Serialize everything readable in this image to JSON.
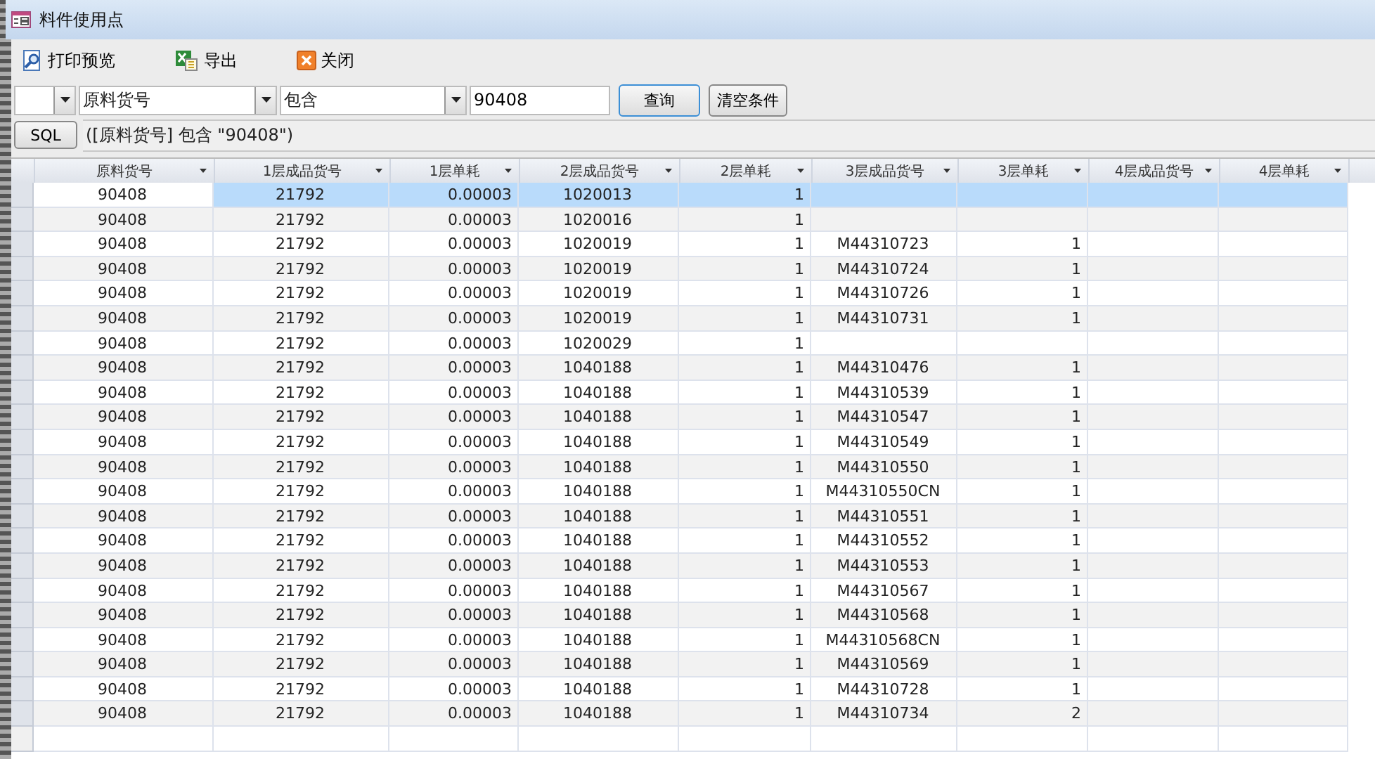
{
  "window": {
    "title": "料件使用点"
  },
  "toolbar": [
    {
      "label": "打印预览",
      "kind": "preview"
    },
    {
      "label": "导出",
      "kind": "export"
    },
    {
      "label": "关闭",
      "kind": "close"
    }
  ],
  "filter": {
    "field": "原料货号",
    "operator": "包含",
    "value": "90408",
    "buttons": [
      "查询",
      "清空条件"
    ]
  },
  "sql": {
    "button": "SQL",
    "expression": "([原料货号] 包含 \"90408\")"
  },
  "table": {
    "columns": [
      "原料货号",
      "1层成品货号",
      "1层单耗",
      "2层成品货号",
      "2层单耗",
      "3层成品货号",
      "3层单耗",
      "4层成品货号",
      "4层单耗"
    ],
    "rows": [
      {
        "selected": true,
        "cells": [
          "90408",
          "21792",
          "0.00003",
          "1020013",
          "1"
        ]
      },
      {
        "selected": false,
        "cells": [
          "90408",
          "21792",
          "0.00003",
          "1020016",
          "1"
        ]
      },
      {
        "selected": false,
        "cells": [
          "90408",
          "21792",
          "0.00003",
          "1020019",
          "1",
          "M44310723",
          "1"
        ]
      },
      {
        "selected": false,
        "cells": [
          "90408",
          "21792",
          "0.00003",
          "1020019",
          "1",
          "M44310724",
          "1"
        ]
      },
      {
        "selected": false,
        "cells": [
          "90408",
          "21792",
          "0.00003",
          "1020019",
          "1",
          "M44310726",
          "1"
        ]
      },
      {
        "selected": false,
        "cells": [
          "90408",
          "21792",
          "0.00003",
          "1020019",
          "1",
          "M44310731",
          "1"
        ]
      },
      {
        "selected": false,
        "cells": [
          "90408",
          "21792",
          "0.00003",
          "1020029",
          "1"
        ]
      },
      {
        "selected": false,
        "cells": [
          "90408",
          "21792",
          "0.00003",
          "1040188",
          "1",
          "M44310476",
          "1"
        ]
      },
      {
        "selected": false,
        "cells": [
          "90408",
          "21792",
          "0.00003",
          "1040188",
          "1",
          "M44310539",
          "1"
        ]
      },
      {
        "selected": false,
        "cells": [
          "90408",
          "21792",
          "0.00003",
          "1040188",
          "1",
          "M44310547",
          "1"
        ]
      },
      {
        "selected": false,
        "cells": [
          "90408",
          "21792",
          "0.00003",
          "1040188",
          "1",
          "M44310549",
          "1"
        ]
      },
      {
        "selected": false,
        "cells": [
          "90408",
          "21792",
          "0.00003",
          "1040188",
          "1",
          "M44310550",
          "1"
        ]
      },
      {
        "selected": false,
        "cells": [
          "90408",
          "21792",
          "0.00003",
          "1040188",
          "1",
          "M44310550CN",
          "1"
        ]
      },
      {
        "selected": false,
        "cells": [
          "90408",
          "21792",
          "0.00003",
          "1040188",
          "1",
          "M44310551",
          "1"
        ]
      },
      {
        "selected": false,
        "cells": [
          "90408",
          "21792",
          "0.00003",
          "1040188",
          "1",
          "M44310552",
          "1"
        ]
      },
      {
        "selected": false,
        "cells": [
          "90408",
          "21792",
          "0.00003",
          "1040188",
          "1",
          "M44310553",
          "1"
        ]
      },
      {
        "selected": false,
        "cells": [
          "90408",
          "21792",
          "0.00003",
          "1040188",
          "1",
          "M44310567",
          "1"
        ]
      },
      {
        "selected": false,
        "cells": [
          "90408",
          "21792",
          "0.00003",
          "1040188",
          "1",
          "M44310568",
          "1"
        ]
      },
      {
        "selected": false,
        "cells": [
          "90408",
          "21792",
          "0.00003",
          "1040188",
          "1",
          "M44310568CN",
          "1"
        ]
      },
      {
        "selected": false,
        "cells": [
          "90408",
          "21792",
          "0.00003",
          "1040188",
          "1",
          "M44310569",
          "1"
        ]
      },
      {
        "selected": false,
        "cells": [
          "90408",
          "21792",
          "0.00003",
          "1040188",
          "1",
          "M44310728",
          "1"
        ]
      },
      {
        "selected": false,
        "cells": [
          "90408",
          "21792",
          "0.00003",
          "1040188",
          "1",
          "M44310734",
          "2"
        ]
      }
    ]
  }
}
